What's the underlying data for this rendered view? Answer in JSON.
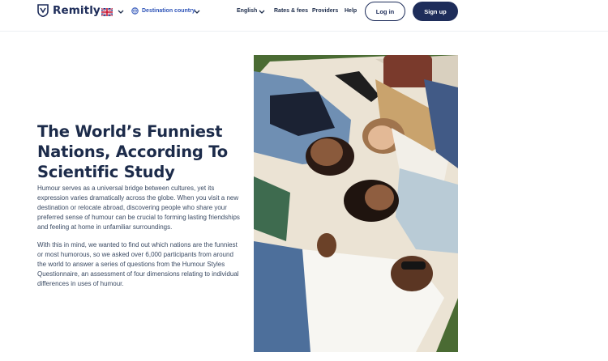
{
  "header": {
    "logo_text": "Remitly",
    "destination_label": "Destination country",
    "nav": {
      "language": "English",
      "rates": "Rates & fees",
      "providers": "Providers",
      "help": "Help"
    },
    "login_label": "Log in",
    "signup_label": "Sign up"
  },
  "icons": {
    "logo": "remitly-shield-icon",
    "flag": "uk-flag-icon",
    "globe": "globe-icon",
    "chevron": "chevron-down-icon"
  },
  "colors": {
    "brand_navy": "#1e2d5a",
    "link_blue": "#2e54b8",
    "body_text": "#3a4a63"
  },
  "article": {
    "title": "The World’s Funniest Nations, According To Scientific Study",
    "paragraph1": "Humour serves as a universal bridge between cultures, yet its expression varies dramatically across the globe. When you visit a new destination or relocate abroad, discovering people who share your preferred sense of humour can be crucial to forming lasting friendships and feeling at home in unfamiliar surroundings.",
    "paragraph2": "With this in mind, we wanted to find out which nations are the funniest or most humorous, so we asked over 6,000 participants from around the world to answer a series of questions from the Humour Styles Questionnaire, an assessment of four dimensions relating to individual differences in uses of humour."
  }
}
